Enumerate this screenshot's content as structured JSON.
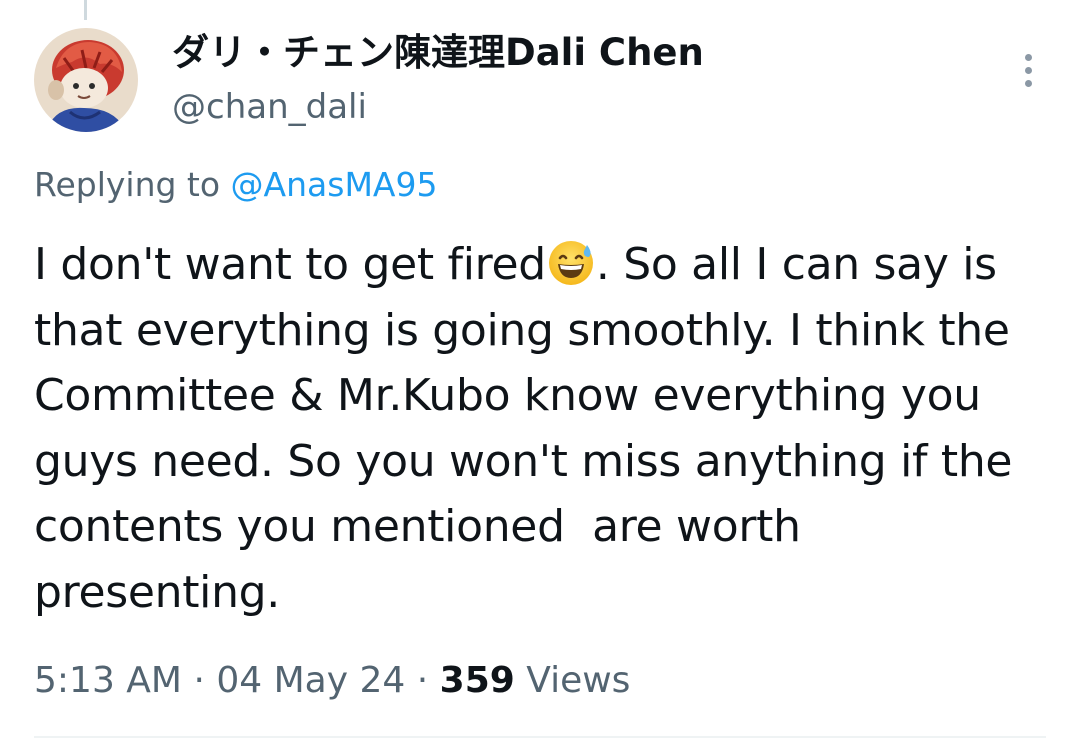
{
  "tweet": {
    "author": {
      "display_name": "ダリ・チェン陳達理Dali Chen",
      "handle": "@chan_dali",
      "avatar_icon": "avatar-illustration"
    },
    "more_icon": "more-vertical-icon",
    "replying_prefix": "Replying to",
    "replying_to": "@AnasMA95",
    "text_part1": "I don't want to get fired",
    "emoji": "grinning-face-with-sweat",
    "text_part2": ". So all I can say is that everything is going smoothly. I think the Committee & Mr.Kubo know everything you guys need. So you won't miss anything if the contents you mentioned  are worth presenting.",
    "time": "5:13 AM",
    "separator": "·",
    "date": "04 May 24",
    "views_count": "359",
    "views_label": "Views"
  },
  "colors": {
    "link": "#1d9bf0",
    "secondary_text": "#536471",
    "primary_text": "#0f1419",
    "divider": "#eff3f4"
  }
}
